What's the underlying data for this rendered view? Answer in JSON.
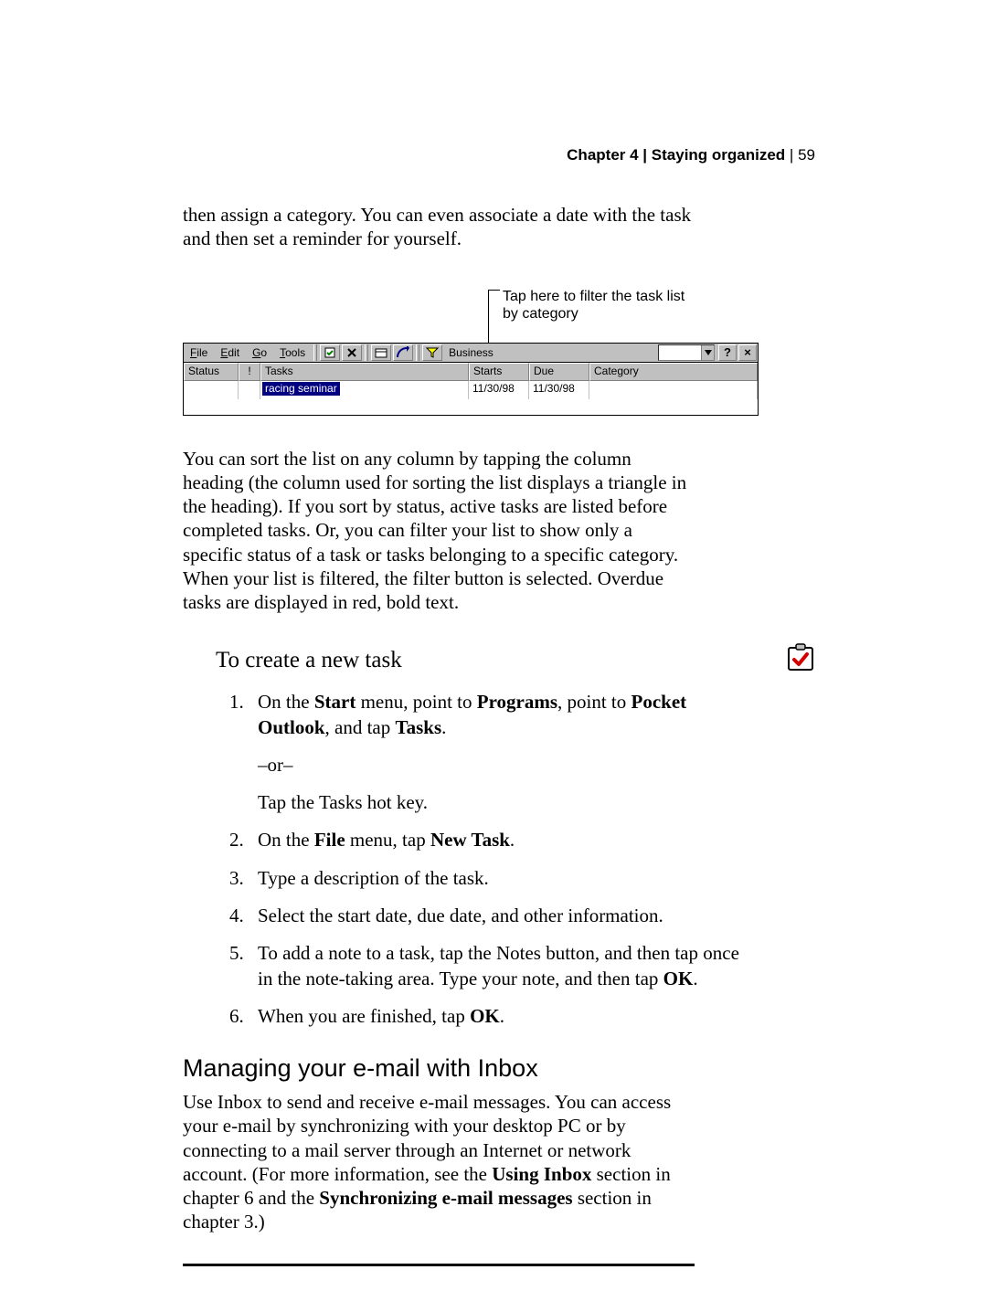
{
  "header": {
    "chapter": "Chapter 4",
    "title": "Staying organized",
    "sep": " | ",
    "page": "59"
  },
  "intro": "then assign a category. You can even associate a date with the task and then set a reminder for yourself.",
  "callout": "Tap here to filter the task list by category",
  "pda": {
    "menus": {
      "file": "File",
      "edit": "Edit",
      "go": "Go",
      "tools": "Tools"
    },
    "filter_label": "Business",
    "help": "?",
    "close": "×",
    "columns": {
      "status": "Status",
      "priority": "!",
      "tasks": "Tasks",
      "starts": "Starts",
      "due": "Due",
      "category": "Category"
    },
    "row": {
      "task": "racing seminar",
      "starts": "11/30/98",
      "due": "11/30/98"
    }
  },
  "para_sort": "You can sort the list on any column by tapping the column heading (the column used for sorting the list displays a triangle in the heading). If you sort by status, active tasks are listed before completed tasks. Or, you can filter your list to show only a specific status of a task or tasks belonging to a specific category. When your list is filtered, the filter button is selected. Overdue tasks are displayed in red, bold text.",
  "proc_title": "To create a new task",
  "steps": {
    "s1a": "On the ",
    "s1b": "Start",
    "s1c": " menu, point to ",
    "s1d": "Programs",
    "s1e": ", point to ",
    "s1f": "Pocket Outlook",
    "s1g": ", and tap ",
    "s1h": "Tasks",
    "s1i": ".",
    "s1_or": "–or–",
    "s1_alt": "Tap the Tasks hot key.",
    "s2a": "On the ",
    "s2b": "File",
    "s2c": " menu, tap ",
    "s2d": "New Task",
    "s2e": ".",
    "s3": "Type a description of the task.",
    "s4": "Select the start date, due date, and other information.",
    "s5a": "To add a note to a task, tap the Notes button, and then tap once in the note-taking area. Type your note, and then tap ",
    "s5b": "OK",
    "s5c": ".",
    "s6a": "When you are finished, tap ",
    "s6b": "OK",
    "s6c": "."
  },
  "h2": "Managing your e-mail with Inbox",
  "inbox_a": "Use Inbox to send and receive e-mail messages. You can access your e-mail by synchronizing with your desktop PC or by connecting to a mail server through an Internet or network account. (For more information, see the ",
  "inbox_b": "Using Inbox",
  "inbox_c": " section in chapter 6 and the ",
  "inbox_d": "Synchronizing e-mail messages",
  "inbox_e": " section in chapter 3.)"
}
